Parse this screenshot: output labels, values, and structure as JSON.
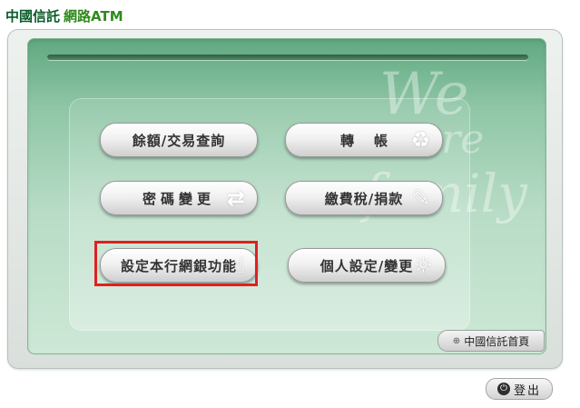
{
  "header": {
    "bank_name": "中國信託",
    "product_name": "網路ATM"
  },
  "watermark": {
    "line1": "We",
    "line2": "are",
    "line3": "family"
  },
  "menu": {
    "balance_query": "餘額/交易查詢",
    "transfer": "轉帳",
    "change_pin": "密碼變更",
    "pay_tax_donate": "繳費稅/捐款",
    "set_online_banking": "設定本行網銀功能",
    "personal_settings": "個人設定/變更"
  },
  "icons": {
    "transfer": "recycle-arrows-icon",
    "change_pin": "swap-arrows-icon",
    "pay": "document-pen-icon",
    "settings": "hand-pointer-icon",
    "personal": "sun-rays-icon"
  },
  "footer": {
    "home_link": "中國信託首頁",
    "logout": "登出"
  },
  "colors": {
    "brand_green": "#0a5b2a",
    "panel_green": "#8fc6a6",
    "highlight_red": "#e02020"
  }
}
